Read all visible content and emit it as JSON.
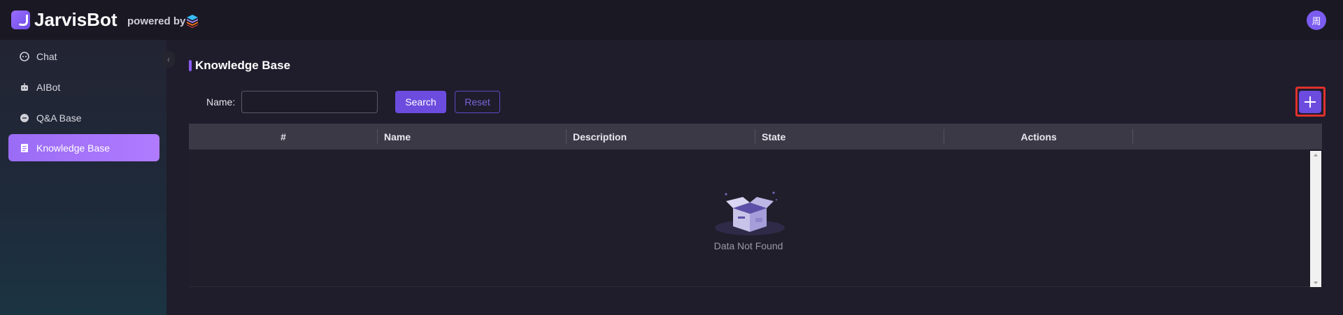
{
  "app": {
    "name": "JarvisBot",
    "powered_by": "powered by",
    "avatar_text": "周"
  },
  "sidebar": {
    "items": [
      {
        "label": "Chat",
        "icon": "chat-icon",
        "active": false
      },
      {
        "label": "AIBot",
        "icon": "robot-icon",
        "active": false
      },
      {
        "label": "Q&A Base",
        "icon": "qa-icon",
        "active": false
      },
      {
        "label": "Knowledge Base",
        "icon": "book-icon",
        "active": true
      }
    ]
  },
  "page": {
    "title": "Knowledge Base"
  },
  "filter": {
    "name_label": "Name:",
    "name_value": "",
    "name_placeholder": "",
    "search_label": "Search",
    "reset_label": "Reset"
  },
  "table": {
    "columns": [
      "#",
      "Name",
      "Description",
      "State",
      "Actions"
    ],
    "rows": [],
    "empty_text": "Data Not Found"
  },
  "colors": {
    "accent": "#6c4cdf",
    "highlight_border": "#e0312c",
    "active_nav": "#a474fb"
  }
}
